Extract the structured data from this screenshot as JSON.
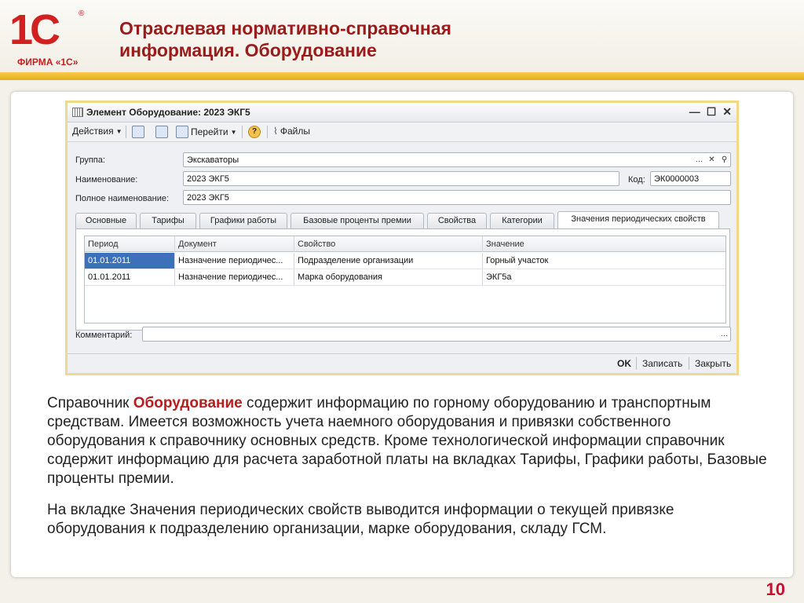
{
  "header": {
    "logo_mark": "1С",
    "logo_reg": "®",
    "logo_firm": "ФИРМА «1С»",
    "title_line1": "Отраслевая нормативно-справочная",
    "title_line2": "информация. Оборудование"
  },
  "window": {
    "title": "Элемент Оборудование: 2023 ЭКГ5",
    "controls": {
      "minimize": "—",
      "maximize": "☐",
      "close": "✕"
    },
    "toolbar": {
      "actions": "Действия",
      "goto": "Перейти",
      "help": "?",
      "files": "Файлы"
    },
    "fields": {
      "group_label": "Группа:",
      "group_value": "Экскаваторы",
      "name_label": "Наименование:",
      "name_value": "2023 ЭКГ5",
      "code_label": "Код:",
      "code_value": "ЭК0000003",
      "fullname_label": "Полное наименование:",
      "fullname_value": "2023 ЭКГ5",
      "comment_label": "Комментарий:",
      "comment_value": ""
    },
    "tabs": [
      "Основные",
      "Тарифы",
      "Графики работы",
      "Базовые проценты премии",
      "Свойства",
      "Категории",
      "Значения периодических свойств"
    ],
    "active_tab": "Значения периодических свойств",
    "grid": {
      "columns": [
        "Период",
        "Документ",
        "Свойство",
        "Значение"
      ],
      "rows": [
        [
          "01.01.2011",
          "Назначение периодичес...",
          "Подразделение организации",
          "Горный участок"
        ],
        [
          "01.01.2011",
          "Назначение периодичес...",
          "Марка оборудования",
          "ЭКГ5а"
        ]
      ]
    },
    "buttons": {
      "ok": "OK",
      "save": "Записать",
      "close": "Закрыть"
    }
  },
  "body": {
    "p1_before": "Справочник ",
    "p1_highlight": "Оборудование",
    "p1_after": " содержит информацию по горному оборудованию и транспортным средствам. Имеется возможность учета наемного оборудования и привязки собственного оборудования к справочнику основных средств. Кроме технологической информации справочник содержит информацию для расчета заработной платы на вкладках Тарифы, Графики работы, Базовые проценты премии.",
    "p2": "На вкладке Значения периодических свойств выводится информации о текущей привязке оборудования к подразделению организации, марке оборудования, складу ГСМ."
  },
  "slide_number": "10",
  "colors": {
    "accent": "#9b1b1b",
    "brand_red": "#d21f1f",
    "bar_yellow": "#f0bb2e",
    "selection": "#3d70b8"
  }
}
